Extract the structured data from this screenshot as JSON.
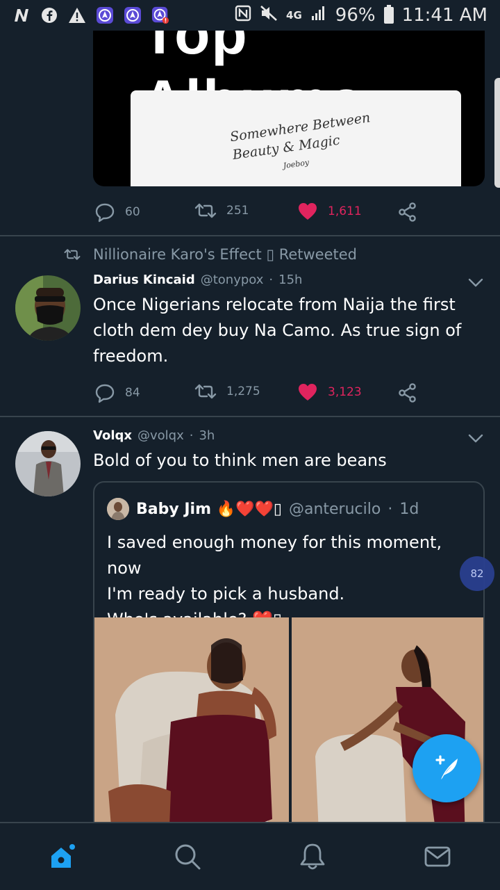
{
  "status_bar": {
    "network": "4G",
    "battery": "96%",
    "time": "11:41 AM"
  },
  "top_tweet": {
    "media_heading": "Top Albums",
    "media_card_text_line1": "Somewhere Between",
    "media_card_text_line2": "Beauty & Magic",
    "media_card_text_small": "Joeboy",
    "replies": "60",
    "retweets": "251",
    "likes": "1,611"
  },
  "tweet1": {
    "retweeted_by": "Nillionaire Karo's Effect ▯ Retweeted",
    "name": "Darius Kincaid",
    "handle": "@tonypox",
    "dot": "·",
    "time": "15h",
    "text": "Once Nigerians relocate from Naija the first cloth dem dey buy Na Camo. As true sign of freedom.",
    "replies": "84",
    "retweets": "1,275",
    "likes": "3,123"
  },
  "tweet2": {
    "name": "Volqx",
    "handle": "@volqx",
    "dot": "·",
    "time": "3h",
    "text": "Bold of you to think men are beans",
    "quote": {
      "name": "Baby Jim 🔥❤️❤️▯",
      "handle": "@anterucilo",
      "dot": "·",
      "time": "1d",
      "line1": "I saved enough money for this moment, now",
      "line2": "I'm ready to pick a husband.",
      "line3": "Who's available? ❤️▯"
    }
  },
  "floating_badge": "82",
  "colors": {
    "background": "#15202b",
    "divider": "#38444d",
    "muted": "#8899a6",
    "like": "#e0245e",
    "accent": "#1da1f2"
  },
  "bottom_nav": {
    "icons": [
      "home-icon",
      "search-icon",
      "notifications-icon",
      "messages-icon"
    ]
  }
}
